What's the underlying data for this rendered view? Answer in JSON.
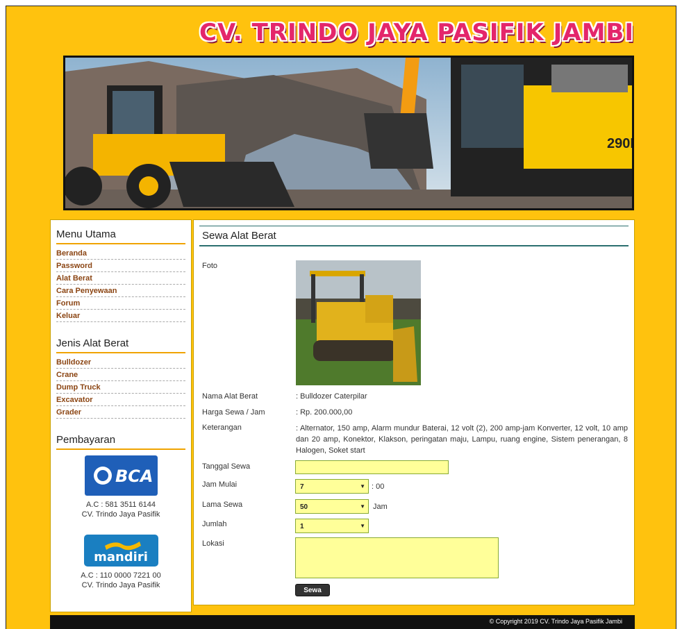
{
  "header": {
    "site_title": "CV. TRINDO JAYA PASIFIK JAMBI"
  },
  "sidebar": {
    "menu_title": "Menu Utama",
    "menu_items": [
      "Beranda",
      "Password",
      "Alat Berat",
      "Cara Penyewaan",
      "Forum",
      "Keluar"
    ],
    "jenis_title": "Jenis Alat Berat",
    "jenis_items": [
      "Bulldozer",
      "Crane",
      "Dump Truck",
      "Excavator",
      "Grader"
    ],
    "pay_title": "Pembayaran",
    "bca": {
      "logo": "BCA",
      "acc": "A.C : 581 3511 6144",
      "name": "CV. Trindo Jaya Pasifik"
    },
    "mandiri": {
      "logo": "mandiri",
      "acc": "A.C : 110 0000 7221 00",
      "name": "CV. Trindo Jaya Pasifik"
    }
  },
  "main": {
    "title": "Sewa Alat Berat",
    "foto_label": "Foto",
    "nama_label": "Nama Alat Berat",
    "nama_value": ": Bulldozer Caterpilar",
    "harga_label": "Harga Sewa / Jam",
    "harga_value": ": Rp. 200.000,00",
    "ket_label": "Keterangan",
    "ket_value": ": Alternator, 150 amp, Alarm mundur Baterai, 12 volt (2), 200 amp-jam Konverter, 12 volt, 10 amp dan 20 amp, Konektor, Klakson, peringatan maju, Lampu, ruang engine, Sistem penerangan, 8 Halogen, Soket start",
    "tanggal_label": "Tanggal Sewa",
    "tanggal_value": "",
    "jam_label": "Jam Mulai",
    "jam_value": "7",
    "jam_suffix": ": 00",
    "lama_label": "Lama Sewa",
    "lama_value": "50",
    "lama_suffix": "Jam",
    "jumlah_label": "Jumlah",
    "jumlah_value": "1",
    "lokasi_label": "Lokasi",
    "lokasi_value": "",
    "submit_label": "Sewa"
  },
  "footer": {
    "copyright": "© Copyright 2019 CV. Trindo Jaya Pasifik Jambi"
  },
  "colors": {
    "page_bg": "#ffc20e",
    "title": "#e4266b",
    "link": "#8b4513",
    "accent_line": "#f0a300",
    "input_bg": "#ffff99"
  }
}
